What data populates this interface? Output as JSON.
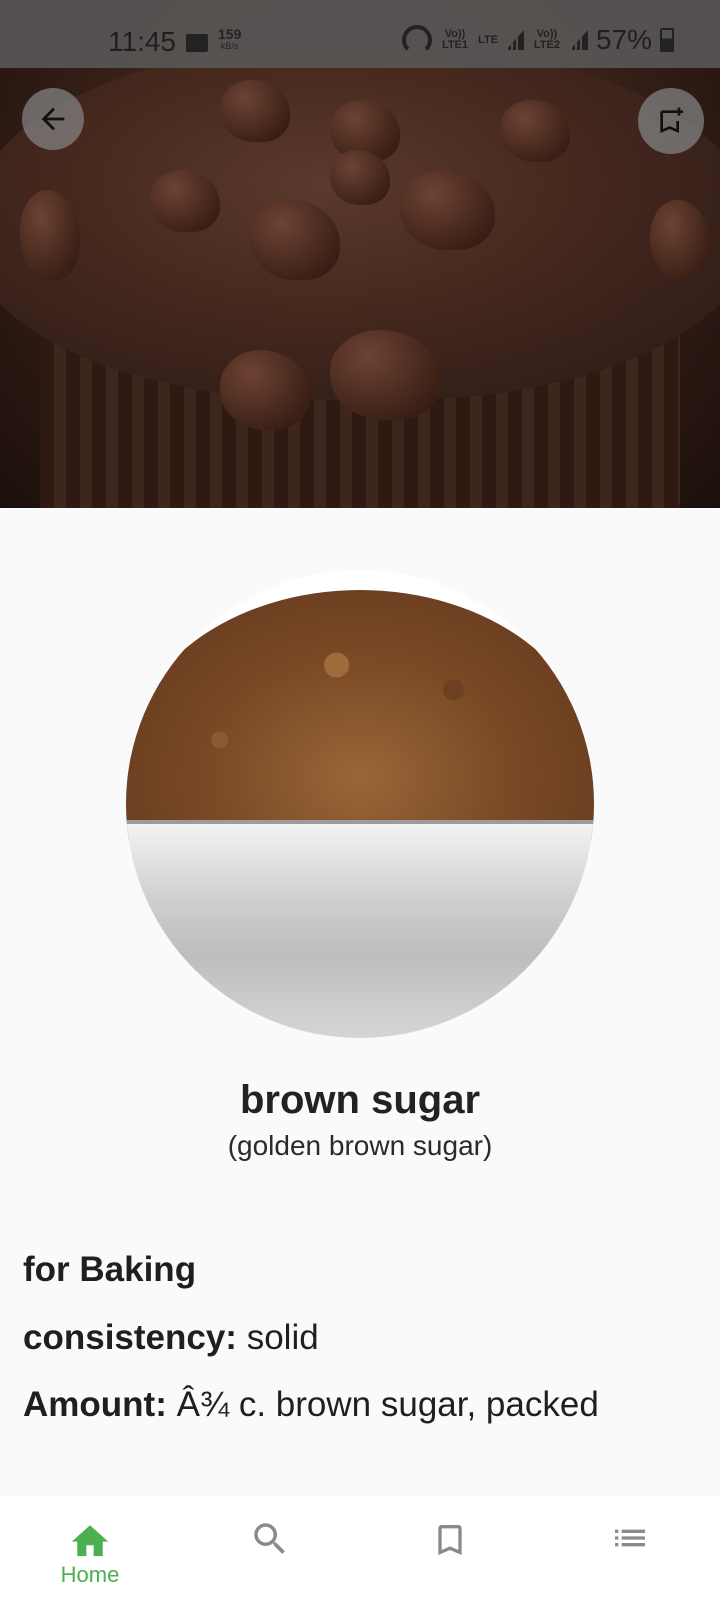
{
  "status_bar": {
    "time": "11:45",
    "speed_value": "159",
    "speed_unit": "kB/s",
    "sim1": "Vo)) LTE1",
    "lte": "LTE",
    "sim2": "Vo)) LTE2",
    "battery": "57%"
  },
  "hero": {
    "image": "chocolate-chip-muffin"
  },
  "ingredient": {
    "image": "brown-sugar-in-bowl",
    "name": "brown sugar",
    "alt_name": "(golden brown sugar)",
    "purpose": "for Baking",
    "consistency_label": "consistency:",
    "consistency_value": "solid",
    "amount_label": "Amount:",
    "amount_value": "Â¾ c. brown sugar, packed"
  },
  "nav": {
    "active_color": "#4caf50",
    "inactive_color": "#8a8a8a",
    "items": [
      {
        "icon": "home-icon",
        "label": "Home",
        "active": true
      },
      {
        "icon": "search-icon",
        "label": "",
        "active": false
      },
      {
        "icon": "bookmark-icon",
        "label": "",
        "active": false
      },
      {
        "icon": "list-icon",
        "label": "",
        "active": false
      }
    ]
  }
}
